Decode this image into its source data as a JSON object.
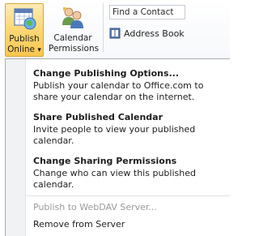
{
  "ribbon": {
    "publish_label": "Publish",
    "publish_label2": "Online",
    "publish_arrow": "▾",
    "perm_label": "Calendar",
    "perm_label2": "Permissions",
    "find_contact": "Find a Contact",
    "address_book": "Address Book"
  },
  "menu": {
    "items": [
      {
        "title": "Change Publishing Options...",
        "desc": "Publish your calendar to Office.com to share your calendar on the internet."
      },
      {
        "title": "Share Published Calendar",
        "desc": "Invite people to view your published calendar."
      },
      {
        "title": "Change Sharing Permissions",
        "desc": "Change who can view this published calendar."
      }
    ],
    "webdav": "Publish to WebDAV Server...",
    "remove": "Remove from Server"
  },
  "colors": {
    "accent": "#f8c64e",
    "disabled": "#9a9a9a"
  },
  "icons": {
    "publish": "calendar-globe-icon",
    "permissions": "people-icon",
    "address_book": "address-book-icon"
  }
}
